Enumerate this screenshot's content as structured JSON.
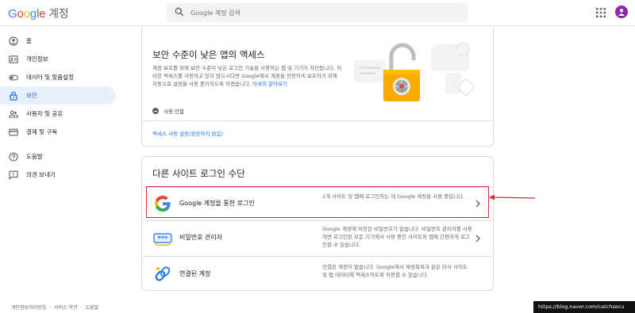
{
  "header": {
    "logo_letters": [
      "G",
      "o",
      "o",
      "g",
      "l",
      "e"
    ],
    "product": "계정",
    "search_placeholder": "Google 계정 검색"
  },
  "sidebar": {
    "items": [
      {
        "label": "홈",
        "icon": "person-circle-icon"
      },
      {
        "label": "개인정보",
        "icon": "id-card-icon"
      },
      {
        "label": "데이터 및 맞춤설정",
        "icon": "toggle-icon"
      },
      {
        "label": "보안",
        "icon": "lock-icon",
        "active": true
      },
      {
        "label": "사용자 및 공유",
        "icon": "people-icon"
      },
      {
        "label": "결제 및 구독",
        "icon": "credit-card-icon"
      },
      {
        "label": "도움말",
        "icon": "help-icon"
      },
      {
        "label": "의견 보내기",
        "icon": "feedback-icon"
      }
    ]
  },
  "footer": {
    "links": [
      "개인정보처리방침",
      "서비스 약관",
      "도움말"
    ]
  },
  "less_secure": {
    "title": "보안 수준이 낮은 앱의 액세스",
    "desc": "계정 보호를 위해 보안 수준이 낮은 로그인 기술을 사용하는 앱 및 기기가 차단됩니다. 이러한 액세스를 사용하고 있지 않으시다면 Google에서 계정을 안전하게 보호하기 위해 자동으로 설정을 사용 중지하도록 하겠습니다.",
    "learn_more": "자세히 알아보기",
    "status": "사용 안함",
    "settings_link": "액세스 사용 설정(권장하지 않음)"
  },
  "other_signin": {
    "title": "다른 사이트 로그인 수단",
    "rows": [
      {
        "label": "Google 계정을 통한 로그인",
        "desc": "2개 사이트 및 앱에 로그인하는 데 Google 계정을 사용 중입니다.",
        "icon": "google-g-icon"
      },
      {
        "label": "비밀번호 관리자",
        "desc": "Google 계정에 저장된 비밀번호가 없습니다. 비밀번호 관리자를 사용하면 로그인된 모든 기기에서 사용 중인 사이트와 앱에 간편하게 로그인할 수 있습니다.",
        "icon": "password-manager-icon"
      },
      {
        "label": "연결된 계정",
        "desc": "연결된 계정이 없습니다. Google에서 재생목록과 같은 타사 사이트 및 앱 데이터에 액세스하도록 허용할 수 있습니다.",
        "icon": "link-icon"
      }
    ]
  },
  "watermark": "https://blog.naver.com/catchsecu",
  "colors": {
    "accent": "#1a73e8",
    "active_bg": "#e8f0fe",
    "highlight": "#d32f2f"
  }
}
